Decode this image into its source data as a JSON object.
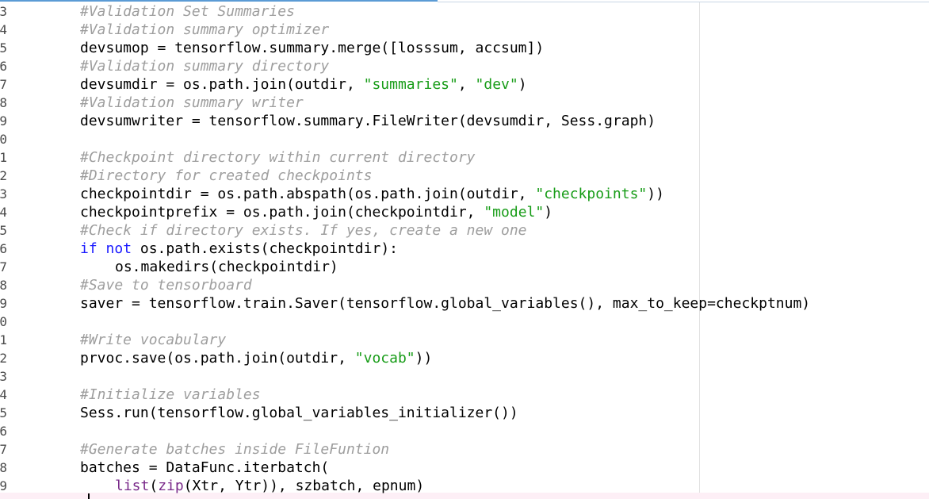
{
  "editor": {
    "line_numbers": [
      "3",
      "4",
      "5",
      "6",
      "7",
      "8",
      "9",
      "0",
      "1",
      "2",
      "3",
      "4",
      "5",
      "6",
      "7",
      "8",
      "9",
      "0",
      "1",
      "2",
      "3",
      "4",
      "5",
      "6",
      "7",
      "8",
      "9"
    ],
    "lines": [
      {
        "indent": 0,
        "tokens": [
          {
            "t": "comment",
            "v": "#Validation Set Summaries"
          }
        ]
      },
      {
        "indent": 0,
        "tokens": [
          {
            "t": "comment",
            "v": "#Validation summary optimizer"
          }
        ]
      },
      {
        "indent": 0,
        "tokens": [
          {
            "t": "plain",
            "v": "devsumop = tensorflow.summary.merge([losssum, accsum])"
          }
        ]
      },
      {
        "indent": 0,
        "tokens": [
          {
            "t": "comment",
            "v": "#Validation summary directory"
          }
        ]
      },
      {
        "indent": 0,
        "tokens": [
          {
            "t": "plain",
            "v": "devsumdir = os.path.join(outdir, "
          },
          {
            "t": "string",
            "v": "\"summaries\""
          },
          {
            "t": "plain",
            "v": ", "
          },
          {
            "t": "string",
            "v": "\"dev\""
          },
          {
            "t": "plain",
            "v": ")"
          }
        ]
      },
      {
        "indent": 0,
        "tokens": [
          {
            "t": "comment",
            "v": "#Validation summary writer"
          }
        ]
      },
      {
        "indent": 0,
        "tokens": [
          {
            "t": "plain",
            "v": "devsumwriter = tensorflow.summary.FileWriter(devsumdir, Sess.graph)"
          }
        ]
      },
      {
        "indent": 0,
        "tokens": []
      },
      {
        "indent": 0,
        "tokens": [
          {
            "t": "comment",
            "v": "#Checkpoint directory within current directory"
          }
        ]
      },
      {
        "indent": 0,
        "tokens": [
          {
            "t": "comment",
            "v": "#Directory for created checkpoints"
          }
        ]
      },
      {
        "indent": 0,
        "tokens": [
          {
            "t": "plain",
            "v": "checkpointdir = os.path.abspath(os.path.join(outdir, "
          },
          {
            "t": "string",
            "v": "\"checkpoints\""
          },
          {
            "t": "plain",
            "v": "))"
          }
        ]
      },
      {
        "indent": 0,
        "tokens": [
          {
            "t": "plain",
            "v": "checkpointprefix = os.path.join(checkpointdir, "
          },
          {
            "t": "string",
            "v": "\"model\""
          },
          {
            "t": "plain",
            "v": ")"
          }
        ]
      },
      {
        "indent": 0,
        "tokens": [
          {
            "t": "comment",
            "v": "#Check if directory exists. If yes, create a new one"
          }
        ]
      },
      {
        "indent": 0,
        "tokens": [
          {
            "t": "kw",
            "v": "if"
          },
          {
            "t": "plain",
            "v": " "
          },
          {
            "t": "kw",
            "v": "not"
          },
          {
            "t": "plain",
            "v": " os.path.exists(checkpointdir):"
          }
        ]
      },
      {
        "indent": 1,
        "tokens": [
          {
            "t": "plain",
            "v": "os.makedirs(checkpointdir)"
          }
        ]
      },
      {
        "indent": 0,
        "tokens": [
          {
            "t": "comment",
            "v": "#Save to tensorboard"
          }
        ]
      },
      {
        "indent": 0,
        "tokens": [
          {
            "t": "plain",
            "v": "saver = tensorflow.train.Saver(tensorflow.global_variables(), max_to_keep=checkptnum)"
          }
        ]
      },
      {
        "indent": 0,
        "tokens": []
      },
      {
        "indent": 0,
        "tokens": [
          {
            "t": "comment",
            "v": "#Write vocabulary"
          }
        ]
      },
      {
        "indent": 0,
        "tokens": [
          {
            "t": "plain",
            "v": "prvoc.save(os.path.join(outdir, "
          },
          {
            "t": "string",
            "v": "\"vocab\""
          },
          {
            "t": "plain",
            "v": "))"
          }
        ]
      },
      {
        "indent": 0,
        "tokens": []
      },
      {
        "indent": 0,
        "tokens": [
          {
            "t": "comment",
            "v": "#Initialize variables"
          }
        ]
      },
      {
        "indent": 0,
        "tokens": [
          {
            "t": "plain",
            "v": "Sess.run(tensorflow.global_variables_initializer())"
          }
        ]
      },
      {
        "indent": 0,
        "tokens": []
      },
      {
        "indent": 0,
        "tokens": [
          {
            "t": "comment",
            "v": "#Generate batches inside FileFuntion"
          }
        ]
      },
      {
        "indent": 0,
        "tokens": [
          {
            "t": "plain",
            "v": "batches = DataFunc.iterbatch("
          }
        ]
      },
      {
        "indent": 1,
        "tokens": [
          {
            "t": "builtin",
            "v": "list"
          },
          {
            "t": "plain",
            "v": "("
          },
          {
            "t": "builtin",
            "v": "zip"
          },
          {
            "t": "plain",
            "v": "(Xtr, Ytr)), szbatch, epnum)"
          }
        ]
      }
    ]
  },
  "colors": {
    "comment": "#9e9e9e",
    "string": "#179c17",
    "keyword": "#1a1aff",
    "builtin": "#7a2a8a",
    "current_line": "#fdeff6"
  }
}
